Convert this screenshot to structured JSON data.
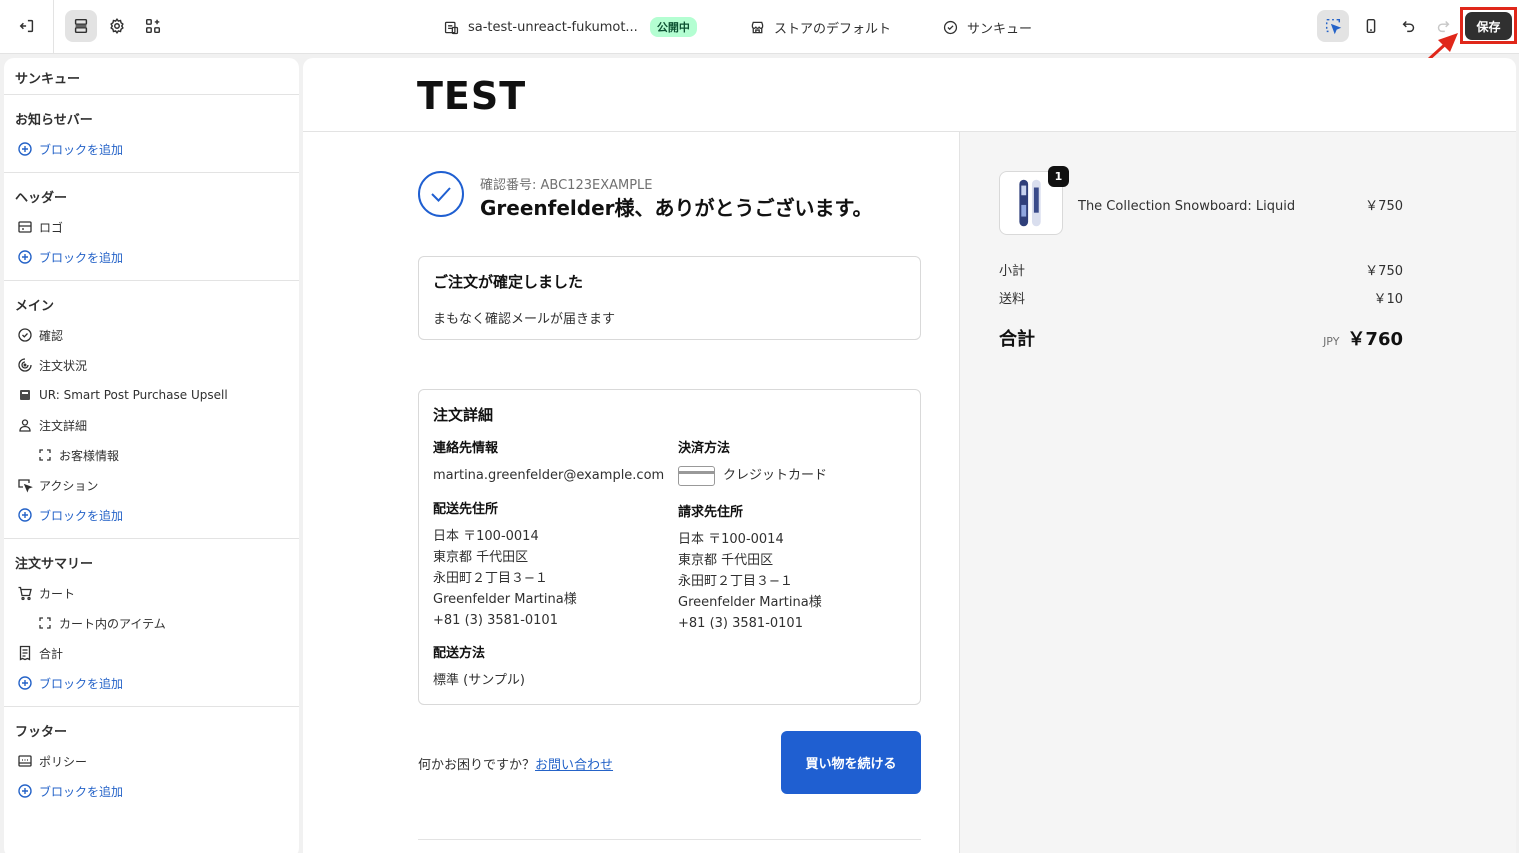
{
  "topbar": {
    "store_name": "sa-test-unreact-fukumot...",
    "live_badge": "公開中",
    "theme_label": "ストアのデフォルト",
    "page_label": "サンキュー",
    "save_label": "保存"
  },
  "sidebar": {
    "title": "サンキュー",
    "sections": [
      {
        "heading": "お知らせバー",
        "add_label": "ブロックを追加"
      },
      {
        "heading": "ヘッダー",
        "items": [
          "ロゴ"
        ],
        "add_label": "ブロックを追加"
      },
      {
        "heading": "メイン",
        "items": [
          "確認",
          "注文状況",
          "UR: Smart Post Purchase Upsell",
          "注文詳細",
          "お客様情報",
          "アクション"
        ],
        "add_label": "ブロックを追加"
      },
      {
        "heading": "注文サマリー",
        "items": [
          "カート",
          "カート内のアイテム",
          "合計"
        ],
        "add_label": "ブロックを追加"
      },
      {
        "heading": "フッター",
        "items": [
          "ポリシー"
        ],
        "add_label": "ブロックを追加"
      }
    ]
  },
  "preview": {
    "logo": "TEST",
    "confirmation_number": "確認番号: ABC123EXAMPLE",
    "thanks": "Greenfelder様、ありがとうございます。",
    "order_confirmed": {
      "title": "ご注文が確定しました",
      "message": "まもなく確認メールが届きます"
    },
    "order_details": {
      "title": "注文詳細",
      "contact_heading": "連絡先情報",
      "contact_email": "martina.greenfelder@example.com",
      "payment_heading": "決済方法",
      "payment_method": "クレジットカード",
      "shipping_address_heading": "配送先住所",
      "shipping_address": [
        "日本 〒100-0014",
        "東京都 千代田区",
        "永田町２丁目３−１",
        "Greenfelder Martina様",
        "+81 (3) 3581-0101"
      ],
      "billing_address_heading": "請求先住所",
      "billing_address": [
        "日本 〒100-0014",
        "東京都 千代田区",
        "永田町２丁目３−１",
        "Greenfelder Martina様",
        "+81 (3) 3581-0101"
      ],
      "shipping_method_heading": "配送方法",
      "shipping_method": "標準 (サンプル)"
    },
    "help_text": "何かお困りですか？",
    "contact_link": "お問い合わせ",
    "continue_button": "買い物を続ける",
    "summary": {
      "product_name": "The Collection Snowboard: Liquid",
      "product_price": "￥750",
      "quantity": "1",
      "subtotal_label": "小計",
      "subtotal": "￥750",
      "shipping_label": "送料",
      "shipping": "￥10",
      "total_label": "合計",
      "currency": "JPY",
      "total": "￥760"
    }
  },
  "colors": {
    "accent": "#1f5fd1",
    "link": "#2563c8",
    "live_badge_bg": "#b4fed2",
    "save_highlight": "#e0271a"
  }
}
